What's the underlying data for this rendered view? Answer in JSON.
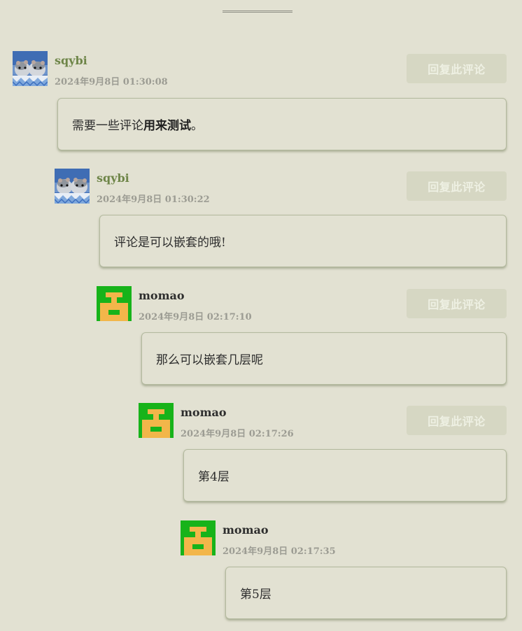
{
  "colors": {
    "background": "#e2e1d2",
    "author_sqybi": "#6e8548",
    "author_momao": "#2e2e2e",
    "timestamp": "#9c9c93",
    "reply_button_bg": "#d6d7c3",
    "reply_button_text": "#eef0e3",
    "avatar_momao_green": "#17b31a",
    "avatar_momao_orange": "#f2b64a"
  },
  "reply_label": "回复此评论",
  "comments": [
    {
      "author": "sqybi",
      "avatar": "hamster-avatar",
      "timestamp": "2024年9月8日 01:30:08",
      "text_before": "需要一些评论",
      "text_bold": "用来测试",
      "text_after": "。"
    },
    {
      "author": "sqybi",
      "avatar": "hamster-avatar",
      "timestamp": "2024年9月8日 01:30:22",
      "text": "评论是可以嵌套的哦!"
    },
    {
      "author": "momao",
      "avatar": "pixel-identicon-avatar",
      "timestamp": "2024年9月8日 02:17:10",
      "text": "那么可以嵌套几层呢"
    },
    {
      "author": "momao",
      "avatar": "pixel-identicon-avatar",
      "timestamp": "2024年9月8日 02:17:26",
      "text": "第4层"
    },
    {
      "author": "momao",
      "avatar": "pixel-identicon-avatar",
      "timestamp": "2024年9月8日 02:17:35",
      "text": "第5层"
    }
  ]
}
